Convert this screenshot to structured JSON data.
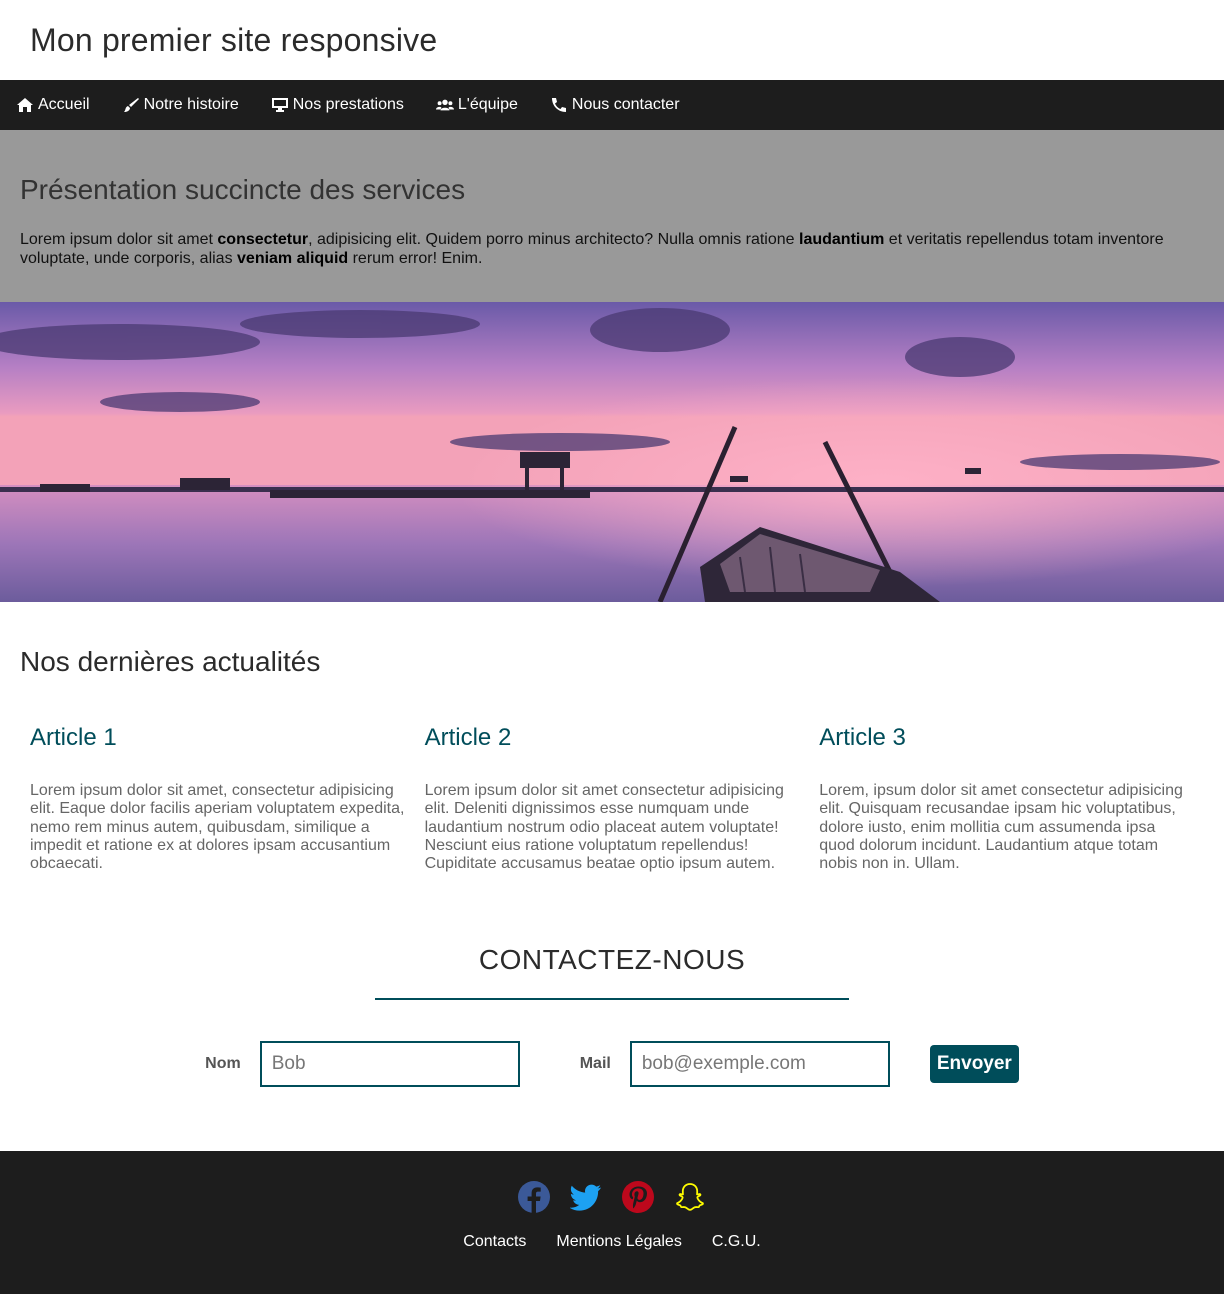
{
  "header": {
    "title": "Mon premier site responsive"
  },
  "nav": {
    "items": [
      {
        "label": "Accueil",
        "icon": "home-icon"
      },
      {
        "label": "Notre histoire",
        "icon": "paintbrush-icon"
      },
      {
        "label": "Nos prestations",
        "icon": "desktop-icon"
      },
      {
        "label": "L'équipe",
        "icon": "users-icon"
      },
      {
        "label": "Nous contacter",
        "icon": "phone-icon"
      }
    ]
  },
  "intro": {
    "title": "Présentation succincte des services",
    "text_1": "Lorem ipsum dolor sit amet ",
    "bold_1": "consectetur",
    "text_2": ", adipisicing elit. Quidem porro minus architecto? Nulla omnis ratione ",
    "bold_2": "laudantium",
    "text_3": " et veritatis repellendus totam inventore voluptate, unde corporis, alias ",
    "bold_3": "veniam aliquid",
    "text_4": " rerum error! Enim."
  },
  "news": {
    "title": "Nos dernières actualités",
    "articles": [
      {
        "title": "Article 1",
        "text": "Lorem ipsum dolor sit amet, consectetur adipisicing elit. Eaque dolor facilis aperiam voluptatem expedita, nemo rem minus autem, quibusdam, similique a impedit et ratione ex at dolores ipsam accusantium obcaecati."
      },
      {
        "title": "Article 2",
        "text": "Lorem ipsum dolor sit amet consectetur adipisicing elit. Deleniti dignissimos esse numquam unde laudantium nostrum odio placeat autem voluptate! Nesciunt eius ratione voluptatum repellendus! Cupiditate accusamus beatae optio ipsum autem."
      },
      {
        "title": "Article 3",
        "text": "Lorem, ipsum dolor sit amet consectetur adipisicing elit. Quisquam recusandae ipsam hic voluptatibus, dolore iusto, enim mollitia cum assumenda ipsa quod dolorum incidunt. Laudantium atque totam nobis non in. Ullam."
      }
    ]
  },
  "contact": {
    "title": "CONTACTEZ-NOUS",
    "name_label": "Nom",
    "name_placeholder": "Bob",
    "mail_label": "Mail",
    "mail_placeholder": "bob@exemple.com",
    "submit_label": "Envoyer"
  },
  "footer": {
    "social": [
      {
        "icon": "facebook-icon",
        "color": "#3b5998"
      },
      {
        "icon": "twitter-icon",
        "color": "#1da1f2"
      },
      {
        "icon": "pinterest-icon",
        "color": "#bd081c"
      },
      {
        "icon": "snapchat-icon",
        "color": "#fffc00"
      }
    ],
    "links": [
      "Contacts",
      "Mentions Légales",
      "C.G.U."
    ]
  },
  "colors": {
    "accent": "#004d5a",
    "nav_bg": "#1d1d1d",
    "intro_bg": "#999999"
  }
}
